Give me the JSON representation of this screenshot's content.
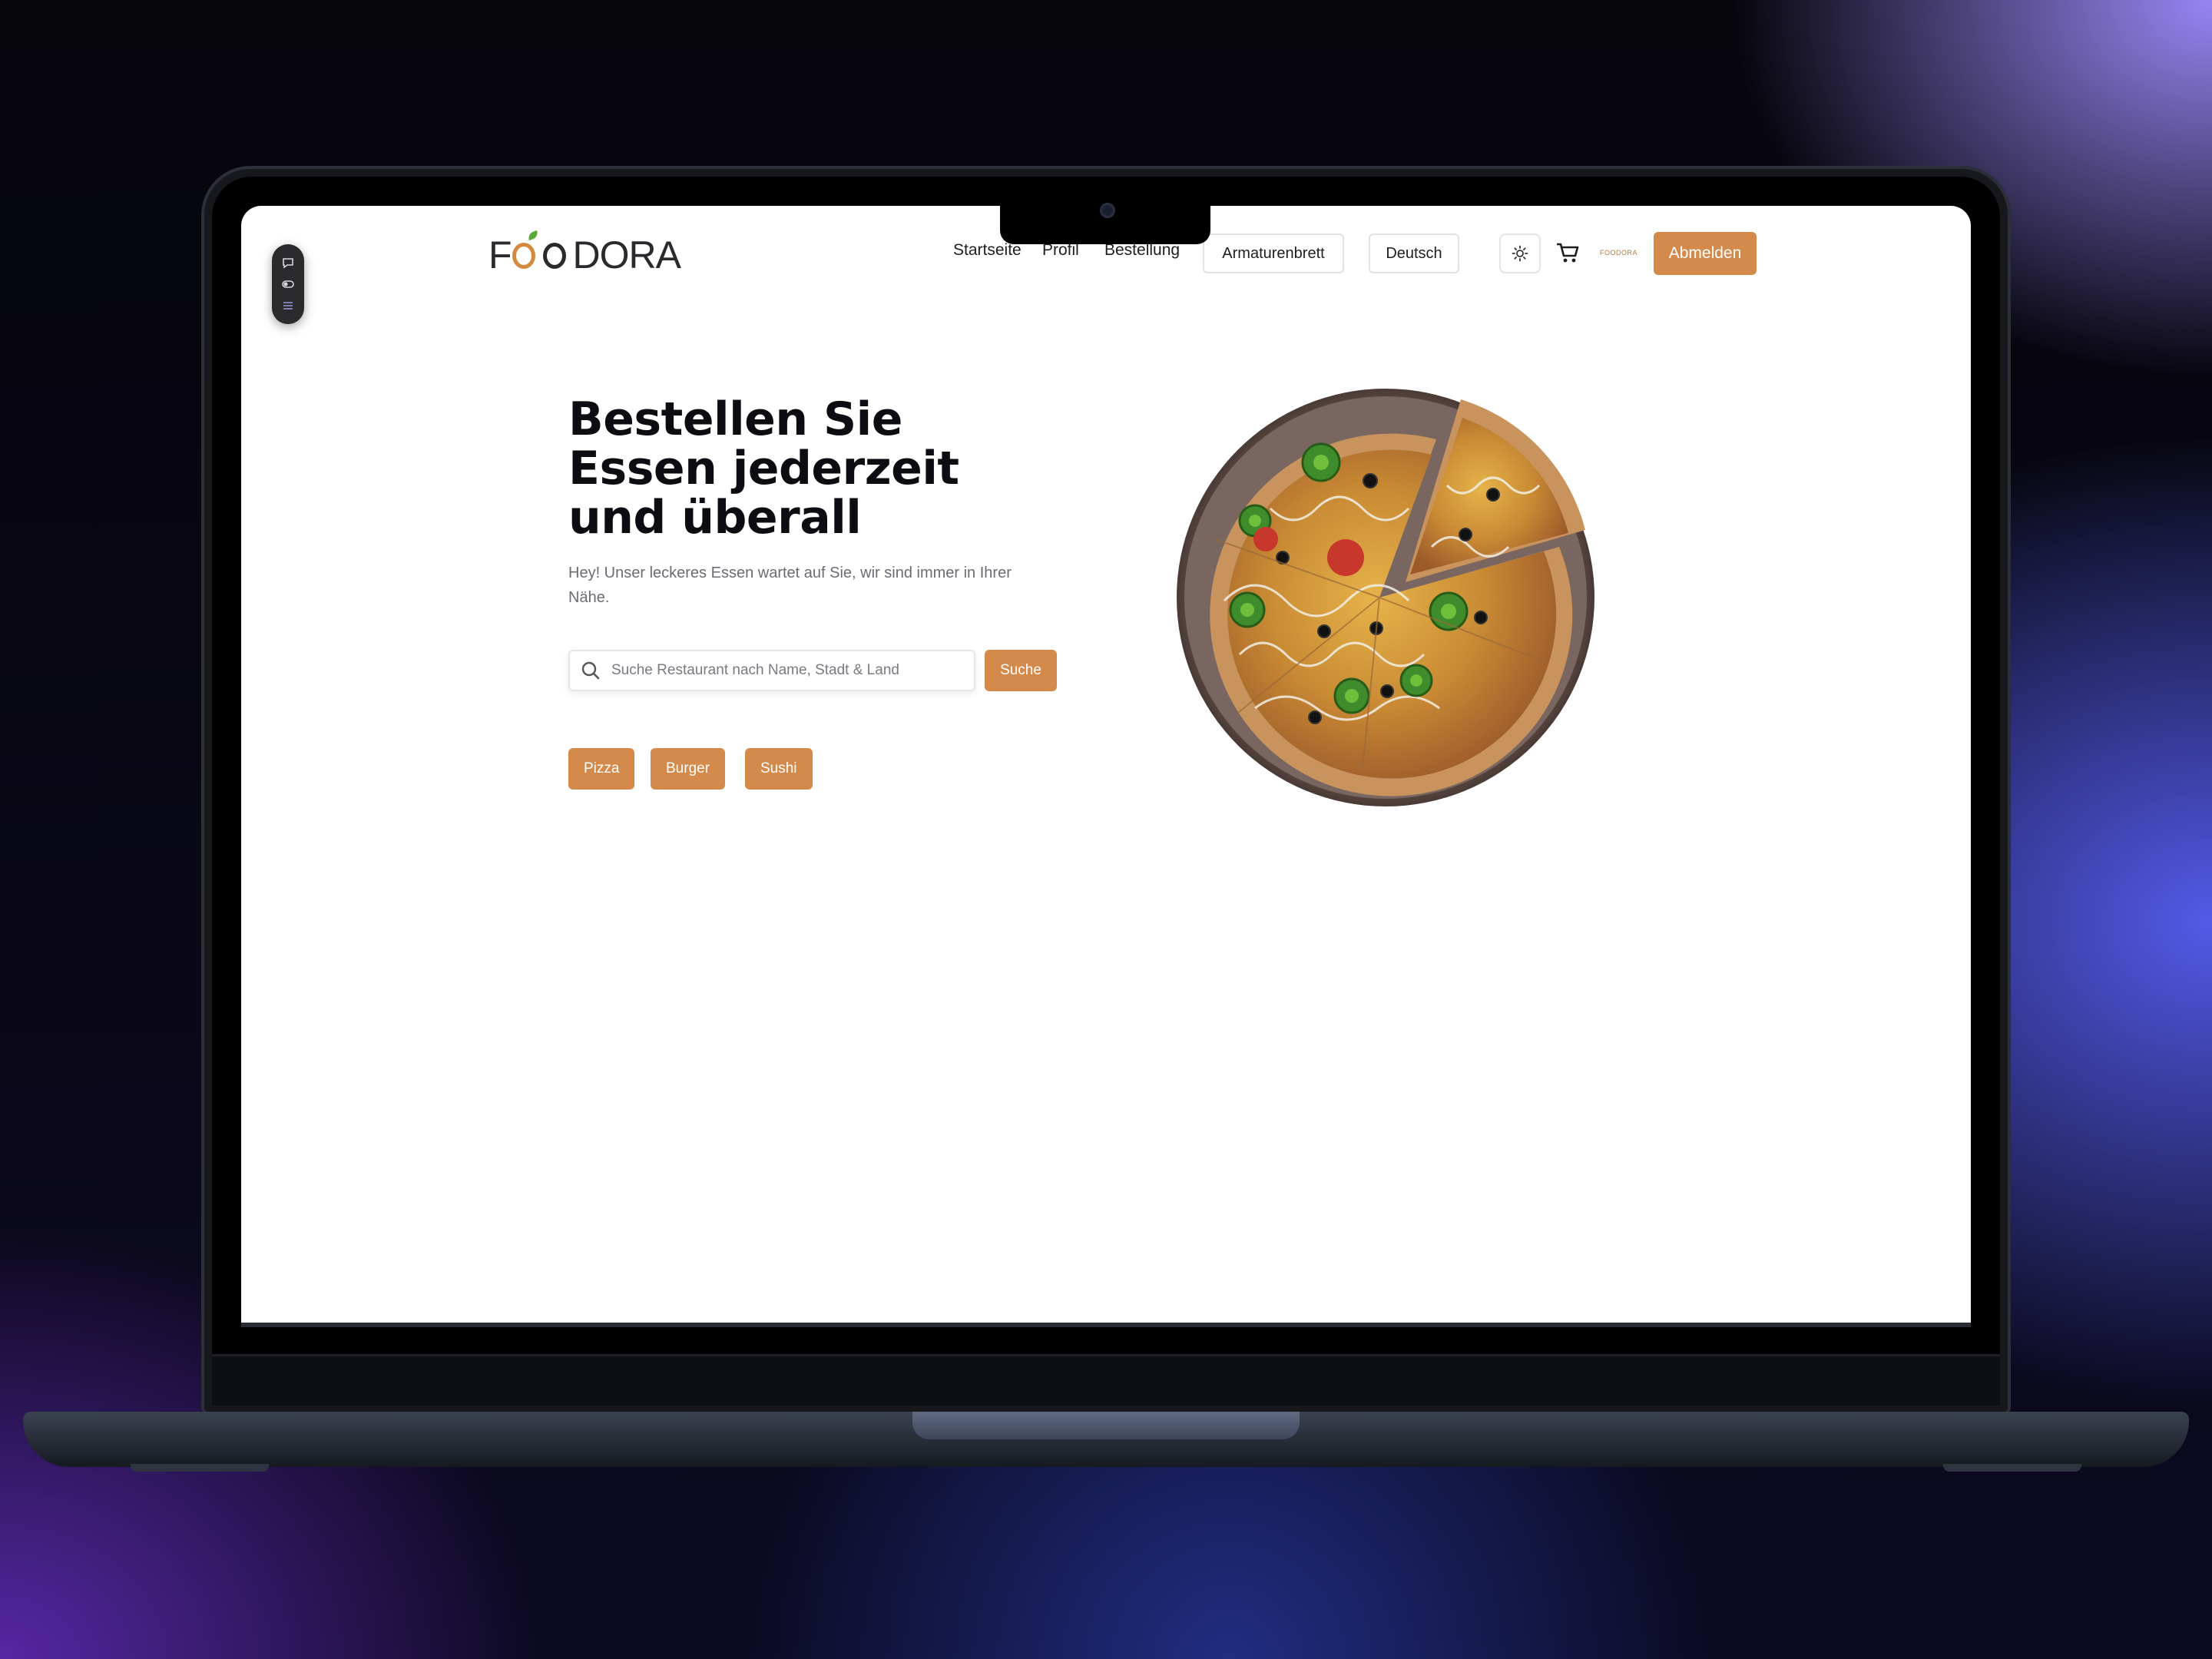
{
  "brand": {
    "logo": "FOODORA",
    "mini_logo": "FOODORA"
  },
  "nav": {
    "links": [
      "Startseite",
      "Profil",
      "Bestellung"
    ],
    "dashboard_label": "Armaturenbrett",
    "language_label": "Deutsch",
    "logout_label": "Abmelden"
  },
  "hero": {
    "title": "Bestellen Sie Essen jederzeit und überall",
    "subtitle": "Hey! Unser leckeres Essen wartet auf Sie, wir sind immer in Ihrer Nähe.",
    "search_placeholder": "Suche Restaurant nach Name, Stadt & Land",
    "search_button": "Suche",
    "categories": [
      "Pizza",
      "Burger",
      "Sushi"
    ]
  },
  "icons": {
    "theme": "sun-icon",
    "cart": "cart-icon",
    "search": "search-icon",
    "side_toolbar": [
      "chat-icon",
      "toggle-icon",
      "list-icon"
    ]
  },
  "colors": {
    "accent": "#d48a4b",
    "text": "#0c0c12",
    "muted": "#6b6b74"
  }
}
